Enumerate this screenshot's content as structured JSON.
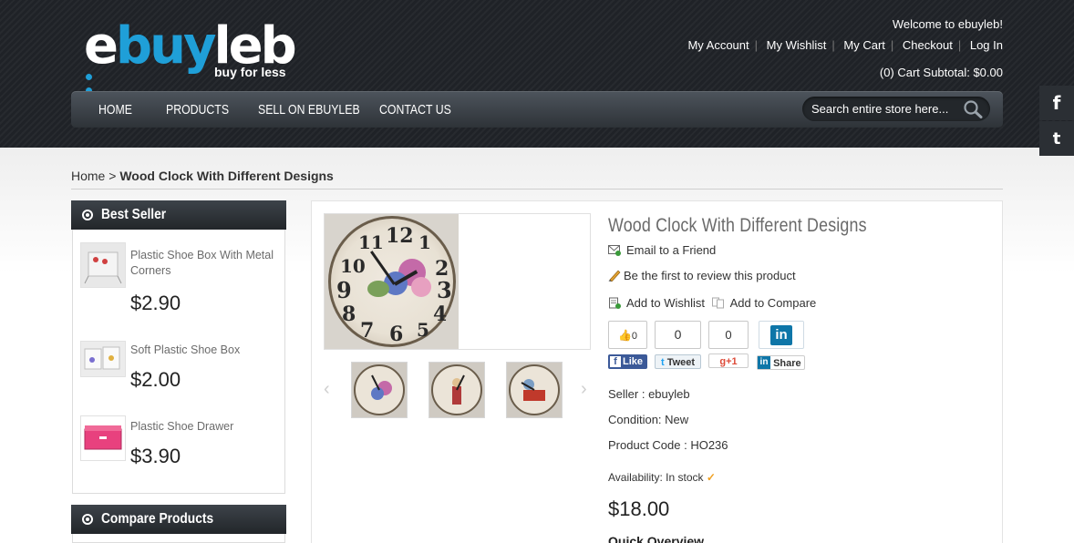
{
  "header": {
    "logo": {
      "e": "e",
      "buy": "buy",
      "leb": "leb",
      "tagline": "buy for less"
    },
    "welcome": "Welcome to ebuyleb!",
    "top_links": [
      "My Account",
      "My Wishlist",
      "My Cart",
      "Checkout",
      "Log In"
    ],
    "cart_subtotal": "(0) Cart Subtotal: $0.00",
    "nav": [
      "HOME",
      "PRODUCTS",
      "SELL ON EBUYLEB",
      "CONTACT US"
    ],
    "search": {
      "placeholder": "Search entire store here..."
    },
    "social": {
      "facebook": "f",
      "twitter": "t"
    }
  },
  "breadcrumb": {
    "home": "Home",
    "separator": " > ",
    "current": "Wood Clock With Different Designs"
  },
  "sidebar": {
    "best_seller_title": "Best Seller",
    "best_sellers": [
      {
        "name": "Plastic Shoe Box With Metal Corners",
        "price": "$2.90"
      },
      {
        "name": "Soft Plastic Shoe Box",
        "price": "$2.00"
      },
      {
        "name": "Plastic Shoe Drawer",
        "price": "$3.90"
      }
    ],
    "compare_title": "Compare Products"
  },
  "product": {
    "title": "Wood Clock With Different Designs",
    "email_friend": "Email to a Friend",
    "review": "Be the first to review this product",
    "add_wishlist": "Add to Wishlist",
    "add_compare": "Add to Compare",
    "share": {
      "fb_count": "0",
      "fb_label": "Like",
      "tw_count": "0",
      "tw_label": "Tweet",
      "gp_count": "0",
      "gp_label": "+1",
      "li_label": "Share",
      "li_icon": "in"
    },
    "seller": "Seller : ebuyleb",
    "condition": "Condition: New",
    "code": "Product Code : HO236",
    "availability_label": "Availability: In stock",
    "price": "$18.00",
    "quick_overview": "Quick Overview"
  },
  "colors": {
    "accent_blue": "#1f9fd8",
    "header_bg": "#1f2227",
    "facebook": "#3b5998",
    "twitter": "#1da1f2",
    "gplus": "#dd4b39",
    "linkedin": "#0e76a8"
  }
}
